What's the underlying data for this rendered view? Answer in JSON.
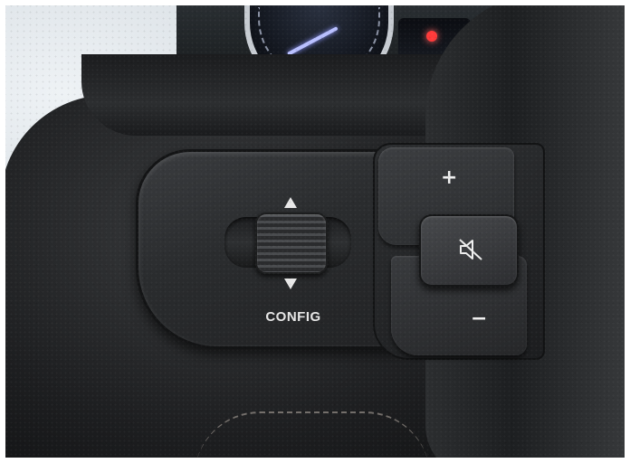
{
  "scene": {
    "description_tag": "steering-wheel-controls"
  },
  "controls": {
    "config_label": "CONFIG",
    "volume_up_symbol": "+",
    "volume_down_symbol": "−",
    "mute_icon": "speaker-mute-icon",
    "scroll_up_icon": "arrow-up-icon",
    "scroll_down_icon": "arrow-down-icon"
  },
  "colors": {
    "leather": "#1d1e20",
    "panel": "#2a2c2e",
    "label_text": "#e6e6e6",
    "warning_light": "#ff3a3a",
    "needle": "#b9c0ff"
  }
}
